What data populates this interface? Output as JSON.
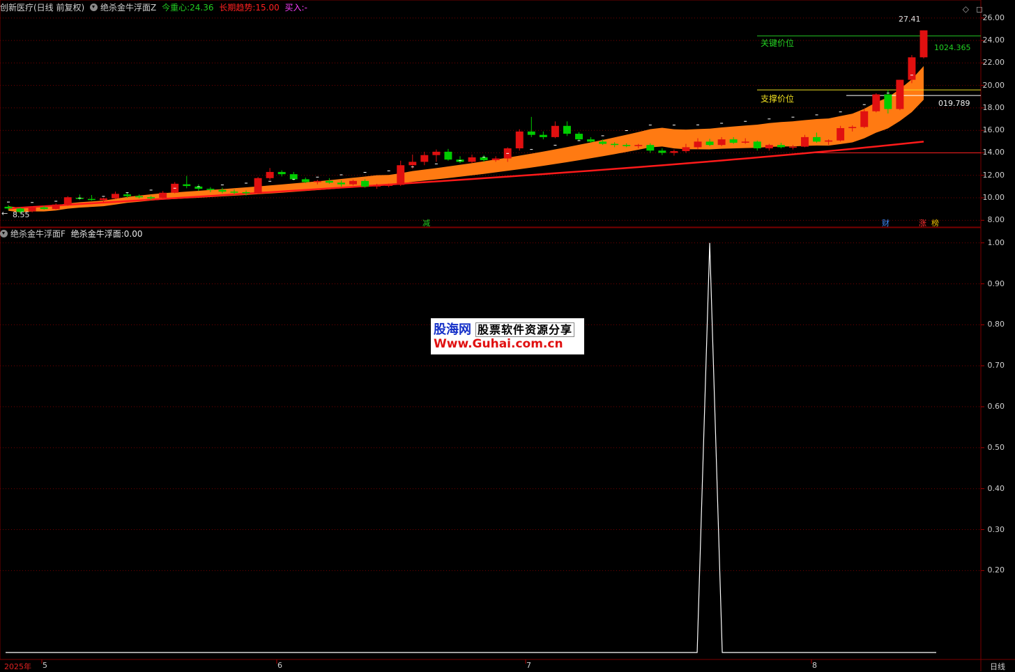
{
  "header": {
    "stock_name": "创新医疗(日线 前复权)",
    "indicator_name": "绝杀金牛浮面Z",
    "gravity_label": "今重心:",
    "gravity_value": "24.36",
    "trend_label": "长期趋势:",
    "trend_value": "15.00",
    "buy_label": "买入:",
    "buy_value": "-"
  },
  "sub_header": {
    "indicator_name": "绝杀金牛浮面F",
    "value_label": "绝杀金牛浮面:",
    "value": "0.00"
  },
  "annotations": {
    "high_price": "27.41",
    "low_price": "8.55",
    "key_level_label": "关键价位",
    "key_level_value": "1024.365",
    "support_label": "支撑价位",
    "support_value": "019.789"
  },
  "markers": {
    "jian": "减",
    "cai": "财",
    "zhang": "涨",
    "bang": "榜"
  },
  "main_yaxis": [
    "26.00",
    "24.00",
    "22.00",
    "20.00",
    "18.00",
    "16.00",
    "14.00",
    "12.00",
    "10.00",
    "8.00"
  ],
  "sub_yaxis": [
    "1.00",
    "0.90",
    "0.80",
    "0.70",
    "0.60",
    "0.50",
    "0.40",
    "0.30",
    "0.20"
  ],
  "xaxis": {
    "year": "2025年",
    "months": [
      "5",
      "6",
      "7",
      "8"
    ],
    "period": "日线"
  },
  "watermark": {
    "line1_brand": "股海网",
    "line1_sub": "股票软件资源分享",
    "line2": "Www.Guhai.com.cn"
  },
  "colors": {
    "up": "#e01010",
    "down": "#00cc00",
    "band": "#ff7a12",
    "trend": "#ff1a1a",
    "key_line": "#22c322",
    "support_line": "#f0e020",
    "grid": "#7a0000"
  },
  "chart_data": [
    {
      "type": "candlestick",
      "title": "创新医疗(日线 前复权)",
      "ylim": [
        7.4,
        27.6
      ],
      "y_ticks": [
        8,
        10,
        12,
        14,
        16,
        18,
        20,
        22,
        24,
        26
      ],
      "ohlc": [
        [
          9.2,
          9.35,
          8.9,
          9.05
        ],
        [
          9.05,
          9.15,
          8.6,
          8.75
        ],
        [
          8.8,
          9.25,
          8.7,
          9.15
        ],
        [
          9.15,
          9.3,
          8.95,
          9.0
        ],
        [
          9.0,
          9.5,
          8.95,
          9.4
        ],
        [
          9.4,
          10.15,
          9.3,
          10.05
        ],
        [
          10.0,
          10.3,
          9.8,
          9.9
        ],
        [
          9.9,
          10.25,
          9.75,
          9.8
        ],
        [
          9.8,
          10.0,
          9.6,
          9.95
        ],
        [
          9.95,
          10.55,
          9.9,
          10.35
        ],
        [
          10.3,
          10.5,
          10.0,
          10.15
        ],
        [
          10.15,
          10.3,
          9.95,
          10.05
        ],
        [
          10.05,
          10.2,
          9.8,
          9.95
        ],
        [
          10.0,
          10.6,
          9.95,
          10.45
        ],
        [
          10.45,
          11.4,
          10.4,
          11.25
        ],
        [
          11.2,
          11.95,
          10.85,
          11.05
        ],
        [
          11.0,
          11.2,
          10.6,
          10.8
        ],
        [
          10.8,
          10.95,
          10.5,
          10.7
        ],
        [
          10.7,
          10.9,
          10.4,
          10.55
        ],
        [
          10.55,
          10.75,
          10.3,
          10.5
        ],
        [
          10.5,
          10.65,
          10.2,
          10.4
        ],
        [
          10.4,
          11.85,
          10.35,
          11.75
        ],
        [
          11.75,
          12.65,
          11.6,
          12.3
        ],
        [
          12.3,
          12.45,
          11.9,
          12.1
        ],
        [
          12.1,
          12.3,
          11.55,
          11.65
        ],
        [
          11.65,
          11.8,
          11.3,
          11.4
        ],
        [
          11.4,
          11.6,
          11.2,
          11.5
        ],
        [
          11.5,
          11.75,
          11.25,
          11.35
        ],
        [
          11.35,
          11.55,
          11.0,
          11.2
        ],
        [
          11.2,
          11.6,
          11.1,
          11.5
        ],
        [
          11.5,
          11.65,
          10.9,
          11.0
        ],
        [
          11.0,
          11.25,
          10.8,
          11.1
        ],
        [
          11.1,
          11.25,
          10.95,
          11.15
        ],
        [
          11.15,
          13.3,
          11.05,
          12.9
        ],
        [
          12.9,
          13.85,
          12.6,
          13.2
        ],
        [
          13.2,
          14.1,
          12.9,
          13.8
        ],
        [
          13.8,
          14.3,
          13.2,
          14.1
        ],
        [
          14.1,
          14.35,
          13.3,
          13.4
        ],
        [
          13.4,
          13.7,
          13.1,
          13.2
        ],
        [
          13.2,
          13.85,
          13.1,
          13.6
        ],
        [
          13.6,
          13.8,
          13.2,
          13.35
        ],
        [
          13.35,
          13.7,
          13.2,
          13.5
        ],
        [
          13.5,
          14.5,
          13.2,
          14.4
        ],
        [
          14.4,
          16.1,
          14.2,
          15.9
        ],
        [
          15.9,
          17.2,
          15.4,
          15.6
        ],
        [
          15.6,
          15.9,
          15.2,
          15.4
        ],
        [
          15.4,
          16.8,
          15.3,
          16.4
        ],
        [
          16.4,
          16.8,
          15.5,
          15.7
        ],
        [
          15.7,
          15.85,
          15.1,
          15.2
        ],
        [
          15.2,
          15.4,
          14.9,
          15.0
        ],
        [
          15.0,
          15.2,
          14.7,
          14.8
        ],
        [
          14.8,
          14.95,
          14.5,
          14.7
        ],
        [
          14.7,
          14.85,
          14.5,
          14.6
        ],
        [
          14.6,
          14.8,
          14.4,
          14.7
        ],
        [
          14.7,
          14.85,
          14.0,
          14.2
        ],
        [
          14.2,
          14.4,
          13.8,
          14.0
        ],
        [
          14.0,
          14.3,
          13.75,
          14.15
        ],
        [
          14.15,
          14.8,
          14.0,
          14.5
        ],
        [
          14.5,
          15.3,
          14.3,
          15.0
        ],
        [
          15.0,
          15.25,
          14.6,
          14.7
        ],
        [
          14.7,
          15.4,
          14.6,
          15.2
        ],
        [
          15.2,
          15.4,
          14.8,
          14.9
        ],
        [
          14.9,
          15.3,
          14.8,
          15.0
        ],
        [
          15.0,
          15.1,
          14.2,
          14.4
        ],
        [
          14.4,
          14.8,
          14.2,
          14.7
        ],
        [
          14.7,
          14.9,
          14.4,
          14.5
        ],
        [
          14.5,
          14.7,
          14.3,
          14.55
        ],
        [
          14.55,
          15.6,
          14.5,
          15.4
        ],
        [
          15.4,
          15.8,
          14.9,
          15.0
        ],
        [
          15.0,
          15.2,
          14.7,
          15.1
        ],
        [
          15.1,
          16.4,
          15.0,
          16.2
        ],
        [
          16.2,
          16.45,
          15.9,
          16.3
        ],
        [
          16.3,
          17.9,
          16.2,
          17.7
        ],
        [
          17.7,
          19.3,
          17.6,
          19.2
        ],
        [
          19.2,
          19.6,
          17.5,
          17.9
        ],
        [
          17.9,
          20.5,
          17.8,
          20.5
        ],
        [
          20.5,
          22.7,
          20.2,
          22.5
        ],
        [
          22.5,
          24.9,
          22.4,
          24.9
        ]
      ],
      "orange_band": {
        "note": "central gravity band",
        "start": [
          9.2,
          9.6
        ],
        "end": [
          17.8,
          20.4
        ]
      },
      "trend_line": {
        "name": "长期趋势",
        "start": 9.05,
        "end": 15.0
      },
      "key_level": 24.4,
      "support_level": 19.6
    },
    {
      "type": "line",
      "title": "绝杀金牛浮面F",
      "ylim": [
        0.0,
        1.02
      ],
      "y_ticks": [
        0.2,
        0.3,
        0.4,
        0.5,
        0.6,
        0.7,
        0.8,
        0.9,
        1.0
      ],
      "series": [
        {
          "name": "绝杀金牛浮面",
          "spike_index": 59,
          "spike_value": 1.0,
          "base_value": 0.0
        }
      ]
    }
  ]
}
